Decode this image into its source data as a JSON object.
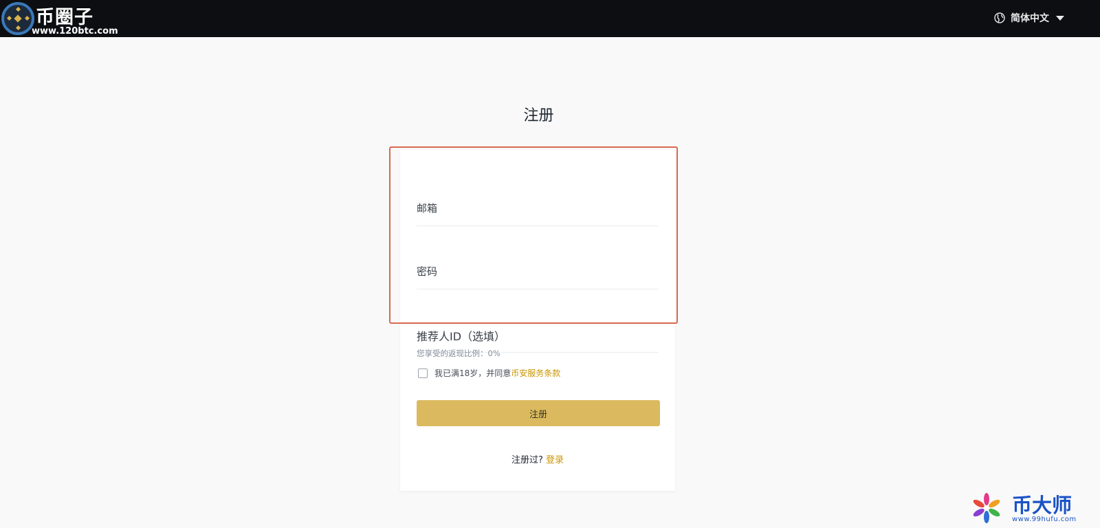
{
  "header": {
    "logo_text": "币圈子",
    "logo_url": "www.120btc.com",
    "language": "简体中文"
  },
  "page_title": "注册",
  "form": {
    "email_label": "邮箱",
    "password_label": "密码",
    "referral_label": "推荐人ID（选填）",
    "rebate_text": "您享受的返现比例：0%",
    "agree_text": "我已满18岁，并同意",
    "terms_link": "币安服务条款",
    "agree_checked": false,
    "submit_label": "注册",
    "login_prompt": "注册过?",
    "login_link": "登录"
  },
  "watermark": {
    "brand": "币大师",
    "url": "www.99hufu.com"
  },
  "colors": {
    "topbar": "#0c0e12",
    "accent": "#dbba5f",
    "link": "#c99400",
    "highlight": "#d9694f",
    "watermark": "#1a52c6"
  }
}
